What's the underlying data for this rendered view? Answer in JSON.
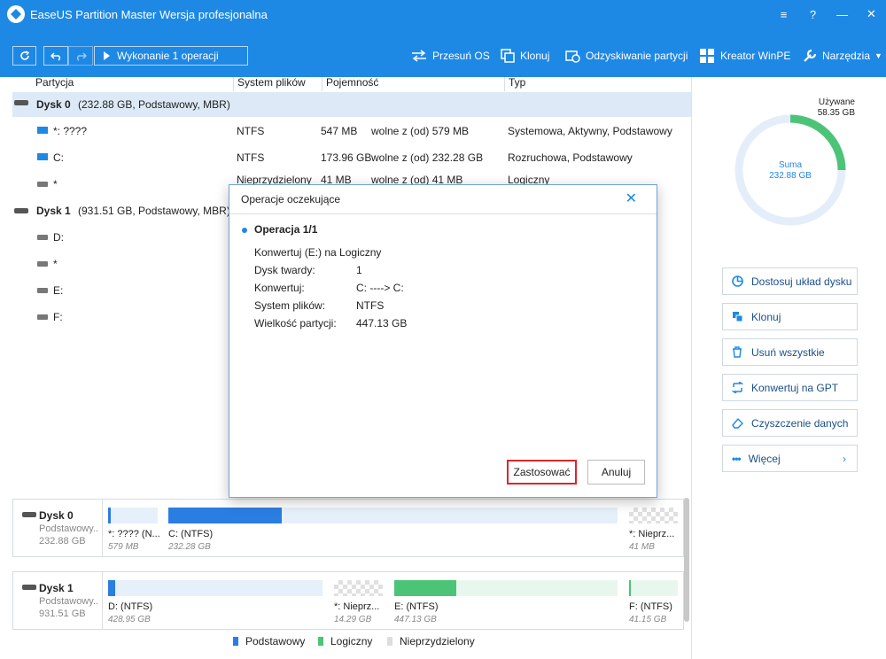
{
  "window": {
    "title": "EaseUS Partition Master Wersja profesjonalna"
  },
  "toolbar": {
    "execute_label": "Wykonanie 1 operacji",
    "tools": [
      {
        "label": "Przesuń OS",
        "icon": "migrate-icon"
      },
      {
        "label": "Klonuj",
        "icon": "clone-icon"
      },
      {
        "label": "Odzyskiwanie partycji",
        "icon": "recovery-icon"
      },
      {
        "label": "Kreator WinPE",
        "icon": "windows-icon"
      },
      {
        "label": "Narzędzia",
        "icon": "wrench-icon"
      }
    ]
  },
  "columns": {
    "partition": "Partycja",
    "filesystem": "System plików",
    "capacity": "Pojemność",
    "type": "Typ"
  },
  "rows": [
    {
      "name": "Dysk 0",
      "detail": "(232.88 GB, Podstawowy, MBR)"
    },
    {
      "name": "*: ????",
      "fs": "NTFS",
      "cap": "547 MB",
      "free": "wolne z (od) 579 MB",
      "type": "Systemowa, Aktywny, Podstawowy"
    },
    {
      "name": "C:",
      "fs": "NTFS",
      "cap": "173.96 GB",
      "free": "wolne z (od) 232.28 GB",
      "type": "Rozruchowa, Podstawowy"
    },
    {
      "name": "*",
      "fs": "Nieprzydzielony",
      "cap": "41 MB",
      "free": "wolne z (od) 41 MB",
      "type": "Logiczny"
    },
    {
      "name": "Dysk 1",
      "detail": "(931.51 GB, Podstawowy, MBR)"
    },
    {
      "name": "D:"
    },
    {
      "name": "*"
    },
    {
      "name": "E:"
    },
    {
      "name": "F:"
    }
  ],
  "usage": {
    "used_label": "Używane",
    "used_value": "58.35 GB",
    "sum_label": "Suma",
    "sum_value": "232.88 GB",
    "used_fraction": 0.25
  },
  "actions": [
    "Dostosuj układ dysku",
    "Klonuj",
    "Usuń wszystkie",
    "Konwertuj na GPT",
    "Czyszczenie danych",
    "Więcej"
  ],
  "disks": [
    {
      "name": "Dysk 0",
      "sub": "Podstawowy..",
      "size": "232.88 GB",
      "segments": [
        {
          "label": "*: ???? (N...",
          "size": "579 MB"
        },
        {
          "label": "C:  (NTFS)",
          "size": "232.28 GB"
        },
        {
          "label": "*: Nieprz...",
          "size": "41 MB"
        }
      ]
    },
    {
      "name": "Dysk 1",
      "sub": "Podstawowy..",
      "size": "931.51 GB",
      "segments": [
        {
          "label": "D:  (NTFS)",
          "size": "428.95 GB"
        },
        {
          "label": "*: Nieprz...",
          "size": "14.29 GB"
        },
        {
          "label": "E:  (NTFS)",
          "size": "447.13 GB"
        },
        {
          "label": "F:  (NTFS)",
          "size": "41.15 GB"
        }
      ]
    }
  ],
  "legend": [
    {
      "label": "Podstawowy",
      "color": "#2a7de1"
    },
    {
      "label": "Logiczny",
      "color": "#4cc477"
    },
    {
      "label": "Nieprzydzielony",
      "color": "#dddddd"
    }
  ],
  "dialog": {
    "title": "Operacje oczekujące",
    "op_title": "Operacja 1/1",
    "op_desc": "Konwertuj (E:) na Logiczny",
    "fields": [
      {
        "k": "Dysk twardy:",
        "v": "1"
      },
      {
        "k": "Konwertuj:",
        "v": "C: ----> C:"
      },
      {
        "k": "System plików:",
        "v": "NTFS"
      },
      {
        "k": "Wielkość partycji:",
        "v": "447.13 GB"
      }
    ],
    "apply": "Zastosować",
    "cancel": "Anuluj"
  }
}
